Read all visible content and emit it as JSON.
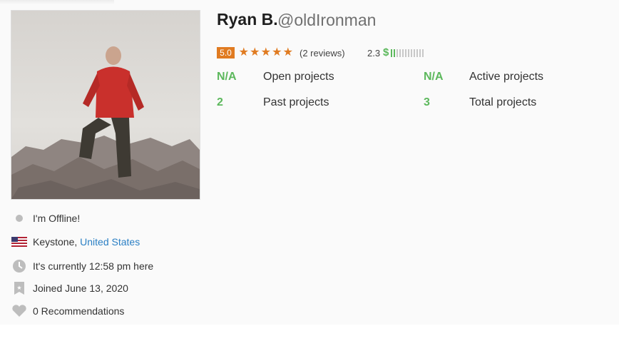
{
  "profile": {
    "name": "Ryan B.",
    "handle": "@oldIronman",
    "rating": "5.0",
    "reviews": "(2 reviews)",
    "earnings_score": "2.3",
    "earnings_symbol": "$",
    "earnings_level": 0.2
  },
  "stats": [
    {
      "value": "N/A",
      "label": "Open projects"
    },
    {
      "value": "N/A",
      "label": "Active projects"
    },
    {
      "value": "2",
      "label": "Past projects"
    },
    {
      "value": "3",
      "label": "Total projects"
    }
  ],
  "info": {
    "status": "I'm Offline!",
    "city": "Keystone, ",
    "country": "United States",
    "local_time": "It's currently 12:58 pm here",
    "joined": "Joined June 13, 2020",
    "recommendations": "0 Recommendations"
  },
  "colors": {
    "accent_orange": "#e07b21",
    "accent_green": "#5cb85c",
    "link_blue": "#2a7fc4"
  },
  "icons": [
    "status-dot-icon",
    "us-flag-icon",
    "clock-icon",
    "badge-icon",
    "heart-icon",
    "star-icon"
  ]
}
